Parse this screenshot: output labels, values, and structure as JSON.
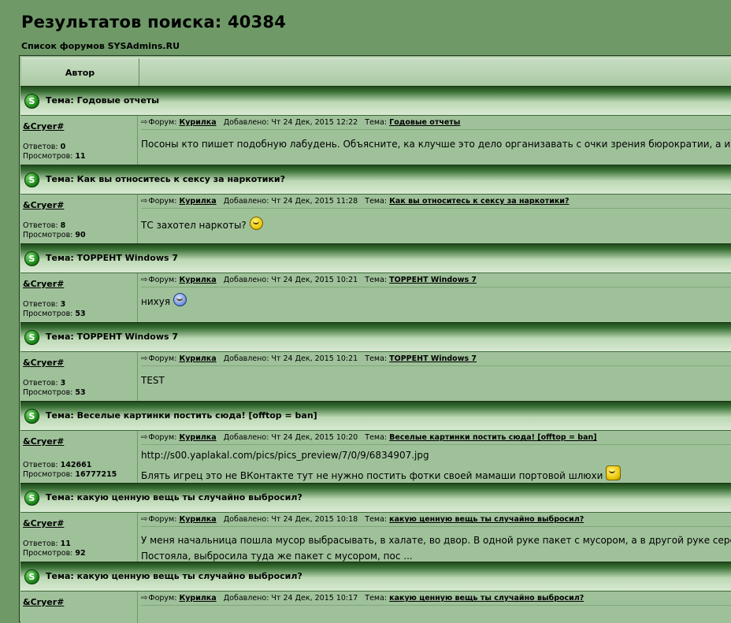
{
  "page": {
    "title": "Результатов поиска: 40384",
    "breadcrumb": "Список форумов SYSAdmins.RU"
  },
  "table": {
    "col_author": "Автор",
    "col_message": ""
  },
  "labels": {
    "topic_prefix": "Тема:",
    "replies": "Ответов:",
    "views": "Просмотров:",
    "forum": "Форум:",
    "added": "Добавлено:",
    "topic": "Тема:"
  },
  "icons": {
    "topic_icon": "s-topic-icon",
    "post_arrow": "arrow-icon"
  },
  "results": [
    {
      "topic": "Годовые отчеты",
      "author": "&Cryer#",
      "replies": "0",
      "views": "11",
      "forum": "Курилка",
      "date": "Чт 24 Дек, 2015 12:22",
      "topic_link": "Годовые отчеты",
      "lines": [
        "Посоны кто пишет подобную лабудень. Объясните, ка клучше это дело организавать с очки зрения бюрократии, а имен"
      ]
    },
    {
      "topic": "Как вы относитесь к сексу за наркотики?",
      "author": "&Cryer#",
      "replies": "8",
      "views": "90",
      "forum": "Курилка",
      "date": "Чт 24 Дек, 2015 11:28",
      "topic_link": "Как вы относитесь к сексу за наркотики?",
      "lines": [
        "ТС захотел наркоты?"
      ]
    },
    {
      "topic": "ТОРРЕНТ Windows 7",
      "author": "&Cryer#",
      "replies": "3",
      "views": "53",
      "forum": "Курилка",
      "date": "Чт 24 Дек, 2015 10:21",
      "topic_link": "ТОРРЕНТ Windows 7",
      "lines": [
        "нихуя"
      ]
    },
    {
      "topic": "ТОРРЕНТ Windows 7",
      "author": "&Cryer#",
      "replies": "3",
      "views": "53",
      "forum": "Курилка",
      "date": "Чт 24 Дек, 2015 10:21",
      "topic_link": "ТОРРЕНТ Windows 7",
      "lines": [
        "TEST"
      ]
    },
    {
      "topic": "Веселые картинки постить сюда! [offtop = ban]",
      "author": "&Cryer#",
      "replies": "142661",
      "views": "16777215",
      "forum": "Курилка",
      "date": "Чт 24 Дек, 2015 10:20",
      "topic_link": "Веселые картинки постить сюда! [offtop = ban]",
      "lines": [
        "http://s00.yaplakal.com/pics/pics_preview/7/0/9/6834907.jpg",
        "Блять игрец это не ВКонтакте тут не нужно постить фотки своей мамаши портовой шлюхи"
      ]
    },
    {
      "topic": "какую ценную вещь ты случайно выбросил?",
      "author": "&Cryer#",
      "replies": "11",
      "views": "92",
      "forum": "Курилка",
      "date": "Чт 24 Дек, 2015 10:18",
      "topic_link": "какую ценную вещь ты случайно выбросил?",
      "lines": [
        "У меня начальница пошла мусор выбрасывать, в халате, во двор. В одной руке пакет с мусором, а в другой руке сережки",
        "Постояла, выбросила туда же пакет с мусором, пос ..."
      ]
    },
    {
      "topic": "какую ценную вещь ты случайно выбросил?",
      "author": "&Cryer#",
      "forum": "Курилка",
      "date": "Чт 24 Дек, 2015 10:17",
      "topic_link": "какую ценную вещь ты случайно выбросил?"
    }
  ]
}
